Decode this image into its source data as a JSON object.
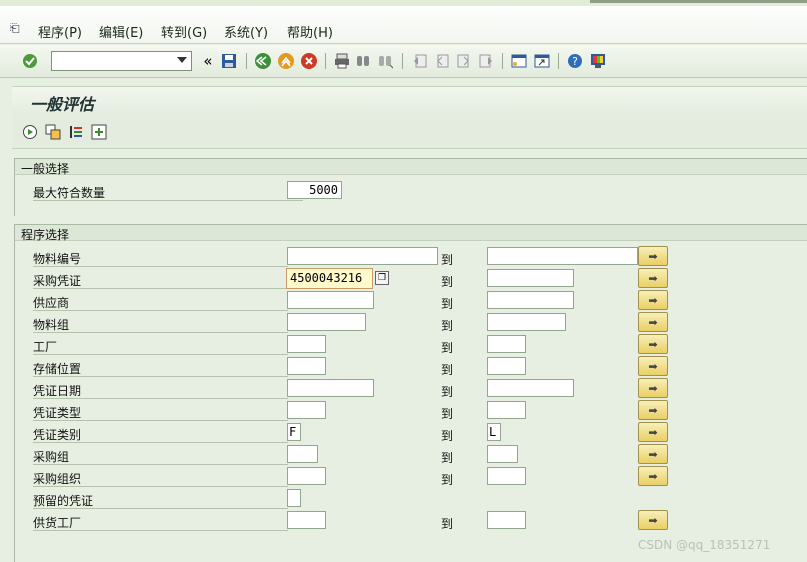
{
  "menu": {
    "items": [
      "程序(P)",
      "编辑(E)",
      "转到(G)",
      "系统(Y)",
      "帮助(H)"
    ]
  },
  "toolbar": {
    "command_value": "",
    "icons": [
      "check-icon",
      "back-icon",
      "save-icon",
      "nav-back-icon",
      "exit-icon",
      "cancel-icon",
      "print-icon",
      "find-icon",
      "find-next-icon",
      "first-page-icon",
      "prev-page-icon",
      "next-page-icon",
      "last-page-icon",
      "new-session-icon",
      "shortcut-icon",
      "help-icon",
      "settings-icon"
    ]
  },
  "title": "一般评估",
  "general_selection": {
    "title": "一般选择",
    "max_hits_label": "最大符合数量",
    "max_hits_value": "5000"
  },
  "program_selection": {
    "title": "程序选择",
    "to_label": "到",
    "rows": [
      {
        "label": "物料编号",
        "from": "",
        "to": ""
      },
      {
        "label": "采购凭证",
        "from": "4500043216",
        "to": ""
      },
      {
        "label": "供应商",
        "from": "",
        "to": ""
      },
      {
        "label": "物料组",
        "from": "",
        "to": ""
      },
      {
        "label": "工厂",
        "from": "",
        "to": ""
      },
      {
        "label": "存储位置",
        "from": "",
        "to": ""
      },
      {
        "label": "凭证日期",
        "from": "",
        "to": ""
      },
      {
        "label": "凭证类型",
        "from": "",
        "to": ""
      },
      {
        "label": "凭证类别",
        "from": "F",
        "to": "L"
      },
      {
        "label": "采购组",
        "from": "",
        "to": ""
      },
      {
        "label": "采购组织",
        "from": "",
        "to": ""
      },
      {
        "label": "预留的凭证",
        "from": "",
        "to": ""
      },
      {
        "label": "供货工厂",
        "from": "",
        "to": ""
      }
    ]
  },
  "watermark": "CSDN @qq_18351271",
  "colors": {
    "background": "#e7efe2",
    "select_button": "#e9cf66",
    "active_field": "#fff9cc"
  }
}
